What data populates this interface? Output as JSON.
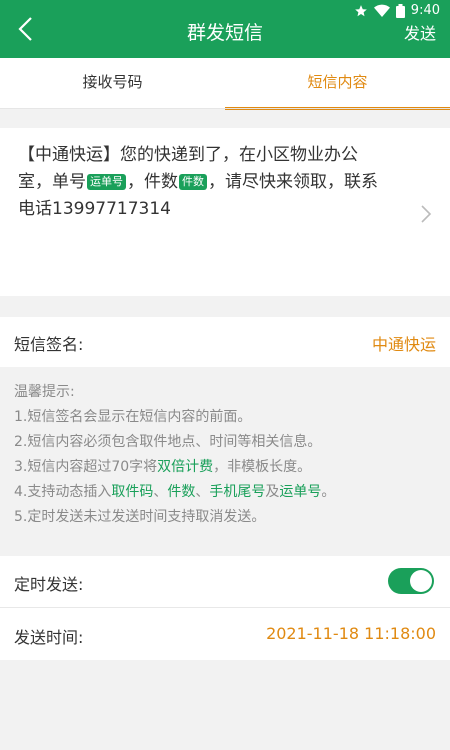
{
  "status_bar": {
    "time": "9:40"
  },
  "header": {
    "title": "群发短信",
    "send_label": "发送"
  },
  "tabs": [
    {
      "label": "接收号码",
      "active": false
    },
    {
      "label": "短信内容",
      "active": true
    }
  ],
  "message": {
    "part1": "【中通快运】您的快递到了，在小区物业办公室，单号",
    "tag_waybill": "运单号",
    "part2": "，件数",
    "tag_count": "件数",
    "part3": "，请尽快来领取，联系电话13997717314"
  },
  "signature": {
    "label": "短信签名:",
    "value": "中通快运"
  },
  "tips": {
    "title": "温馨提示:",
    "line1": "1.短信签名会显示在短信内容的前面。",
    "line2": "2.短信内容必须包含取件地点、时间等相关信息。",
    "line3_a": "3.短信内容超过70字将",
    "line3_hl": "双倍计费",
    "line3_b": "，非模板长度。",
    "line4_a": "4.支持动态插入",
    "line4_hl1": "取件码",
    "line4_sep1": "、",
    "line4_hl2": "件数",
    "line4_sep2": "、",
    "line4_hl3": "手机尾号",
    "line4_sep3": "及",
    "line4_hl4": "运单号",
    "line4_end": "。",
    "line5": "5.定时发送未过发送时间支持取消发送。"
  },
  "scheduled_send": {
    "label": "定时发送:",
    "enabled": true
  },
  "send_time": {
    "label": "发送时间:",
    "value": "2021-11-18 11:18:00"
  },
  "colors": {
    "brand_green": "#1aa05a",
    "accent_orange": "#e08a12"
  }
}
